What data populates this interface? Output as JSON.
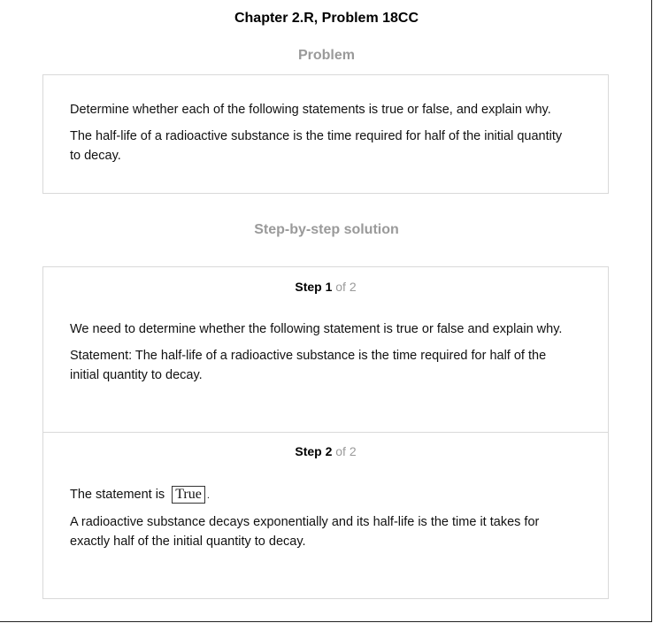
{
  "title": "Chapter 2.R, Problem 18CC",
  "problem": {
    "heading": "Problem",
    "paragraphs": [
      "Determine whether each of the following statements is true or false, and explain why.",
      "The half-life of a radioactive substance is the time required for half of the initial quantity to decay."
    ]
  },
  "solution": {
    "heading": "Step-by-step solution",
    "steps": [
      {
        "label": "Step 1",
        "of_total": "of 2",
        "paragraphs": [
          "We need to determine whether the following statement is true or false and explain why.",
          "Statement: The half-life of a radioactive substance is the time required for half of the initial quantity to decay."
        ]
      },
      {
        "label": "Step 2",
        "of_total": "of 2",
        "answer_prefix": "The statement is",
        "answer_value": "True",
        "answer_suffix": ".",
        "paragraphs": [
          "A radioactive substance decays exponentially and its half-life is the time it takes for exactly half of the initial quantity to decay."
        ]
      }
    ]
  }
}
